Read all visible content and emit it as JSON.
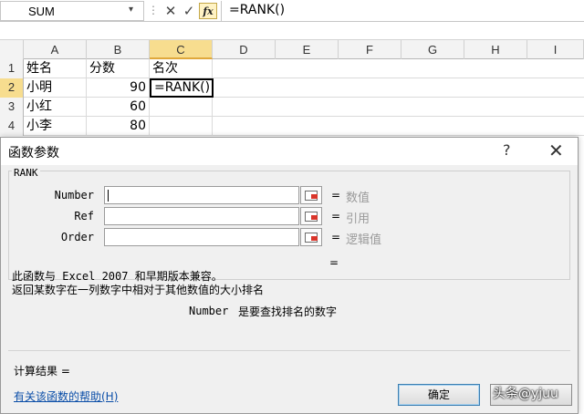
{
  "formula_bar": {
    "name_box": "SUM",
    "name_box_arrow": "▾",
    "dots": "⋮",
    "cancel": "✕",
    "enter": "✓",
    "fx": "fx",
    "formula": "=RANK()"
  },
  "sheet": {
    "columns": [
      "A",
      "B",
      "C",
      "D",
      "E",
      "F",
      "G",
      "H",
      "I"
    ],
    "selected_column": "C",
    "rows": [
      {
        "num": "1",
        "a": "姓名",
        "b": "分数",
        "c": "名次"
      },
      {
        "num": "2",
        "a": "小明",
        "b": "90",
        "c": "=RANK()"
      },
      {
        "num": "3",
        "a": "小红",
        "b": "60",
        "c": ""
      },
      {
        "num": "4",
        "a": "小李",
        "b": "80",
        "c": ""
      }
    ],
    "active_cell": "C2"
  },
  "dialog": {
    "title": "函数参数",
    "help": "?",
    "close": "✕",
    "function_name": "RANK",
    "args": [
      {
        "label": "Number",
        "hint": "数值"
      },
      {
        "label": "Ref",
        "hint": "引用"
      },
      {
        "label": "Order",
        "hint": "逻辑值"
      }
    ],
    "equals": "=",
    "description_line1": "此函数与 Excel 2007 和早期版本兼容。",
    "description_line2": "返回某数字在一列数字中相对于其他数值的大小排名",
    "param_name": "Number",
    "param_desc": "是要查找排名的数字",
    "calc_result": "计算结果 =",
    "help_link": "有关该函数的帮助(H)",
    "ok": "确定"
  },
  "watermark": "头条@yjuu",
  "colors": {
    "selected_header": "#f7dd8f",
    "link": "#0b4ea8",
    "hint_gray": "#9a9a9a"
  }
}
